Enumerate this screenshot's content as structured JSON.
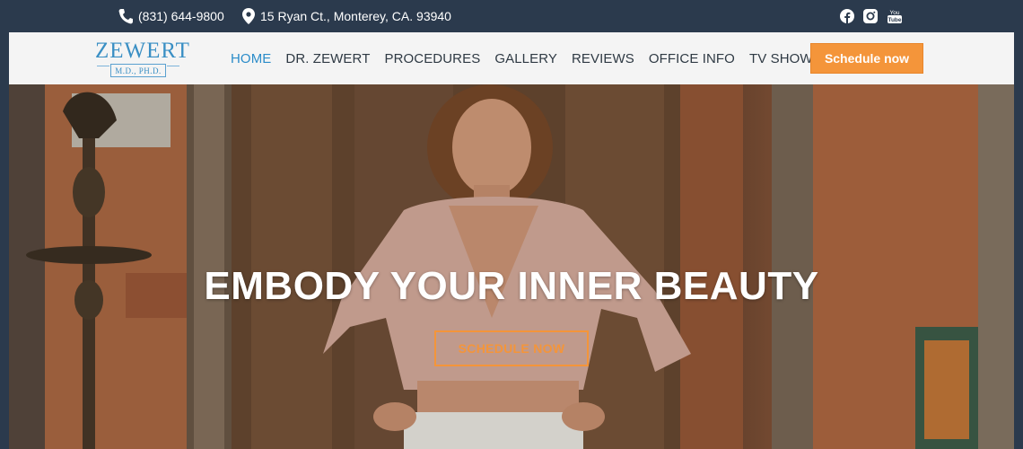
{
  "topbar": {
    "phone": "(831) 644-9800",
    "address": "15 Ryan Ct., Monterey, CA. 93940",
    "icons": {
      "phone": "phone-icon",
      "address": "map-pin-icon"
    },
    "social": [
      "facebook-icon",
      "instagram-icon",
      "youtube-icon"
    ],
    "youtube_text": "You Tube"
  },
  "logo": {
    "name": "ZEWERT",
    "credentials": "M.D., PH.D."
  },
  "nav": {
    "items": [
      {
        "label": "HOME",
        "active": true
      },
      {
        "label": "DR. ZEWERT",
        "active": false
      },
      {
        "label": "PROCEDURES",
        "active": false
      },
      {
        "label": "GALLERY",
        "active": false
      },
      {
        "label": "REVIEWS",
        "active": false
      },
      {
        "label": "OFFICE INFO",
        "active": false
      },
      {
        "label": "TV SHOWS",
        "active": false
      }
    ],
    "cta_label": "Schedule now"
  },
  "hero": {
    "title": "EMBODY YOUR INNER BEAUTY",
    "button_label": "SCHEDULE NOW"
  },
  "colors": {
    "topbar_bg": "#2b3a4d",
    "header_bg": "#f4f4f4",
    "accent_blue": "#2b8cc9",
    "accent_orange": "#f4953a"
  }
}
